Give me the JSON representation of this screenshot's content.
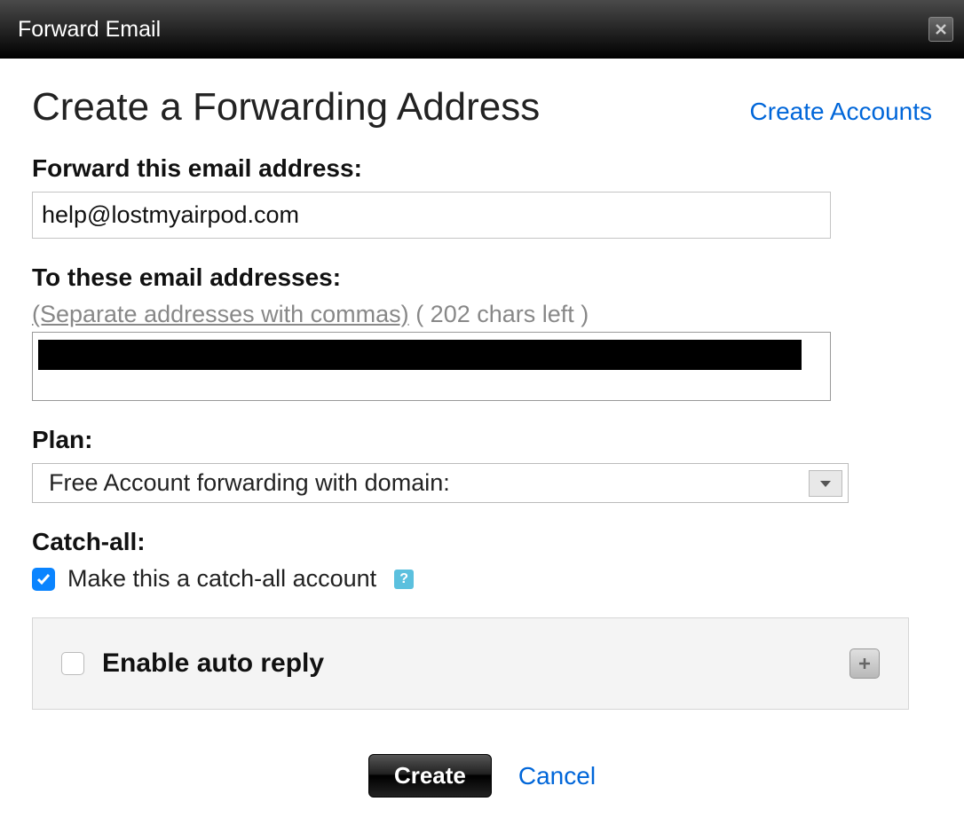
{
  "titlebar": {
    "title": "Forward Email"
  },
  "header": {
    "heading": "Create a Forwarding Address",
    "link": "Create Accounts"
  },
  "forward_from": {
    "label": "Forward this email address:",
    "value": "help@lostmyairpod.com"
  },
  "forward_to": {
    "label": "To these email addresses:",
    "hint_separate": "(Separate addresses with commas)",
    "hint_chars": "( 202 chars left )"
  },
  "plan": {
    "label": "Plan:",
    "selected": "Free Account forwarding with domain:"
  },
  "catchall": {
    "label": "Catch-all:",
    "checkbox_label": "Make this a catch-all account",
    "checked": true
  },
  "autoreply": {
    "label": "Enable auto reply",
    "checked": false
  },
  "buttons": {
    "create": "Create",
    "cancel": "Cancel"
  }
}
